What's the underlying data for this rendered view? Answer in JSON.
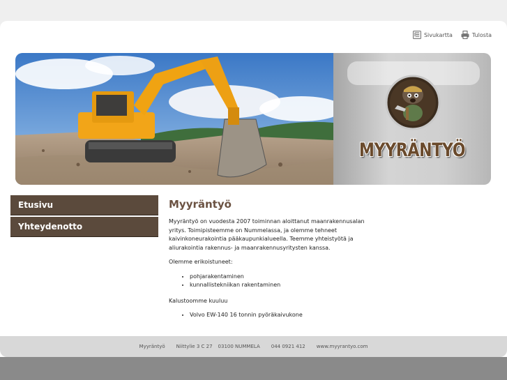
{
  "toplinks": {
    "sitemap": "Sivukartta",
    "print": "Tulosta"
  },
  "logo": {
    "text": "MYYRÄNTYÖ"
  },
  "nav": {
    "items": [
      {
        "label": "Etusivu"
      },
      {
        "label": "Yhteydenotto"
      }
    ]
  },
  "main": {
    "title": "Myyräntyö",
    "intro": "Myyräntyö on vuodesta 2007 toiminnan aloittanut maanrakennusalan yritys. Toimipisteemme on Nummelassa, ja olemme tehneet kaivinkoneurakointia pääkaupunkialueella. Teemme yhteistyötä ja aliurakointia rakennus- ja maanrakennusyritysten kanssa.",
    "specialties_label": "Olemme erikoistuneet:",
    "specialties": [
      "pohjarakentaminen",
      "kunnallistekniikan rakentaminen"
    ],
    "equipment_label": "Kalustoomme kuuluu",
    "equipment": [
      "Volvo EW-140 16 tonnin pyöräkaivukone"
    ]
  },
  "footer": {
    "company": "Myyräntyö",
    "address": "Niittylie 3 C 27",
    "postal": "03100 NUMMELA",
    "phone": "044 0921 412",
    "website": "www.myyrantyo.com"
  },
  "colors": {
    "nav_bg": "#5b4a3c",
    "title": "#6b5242",
    "page_bg": "#efefef",
    "footer_bg": "#d8d8d8"
  }
}
